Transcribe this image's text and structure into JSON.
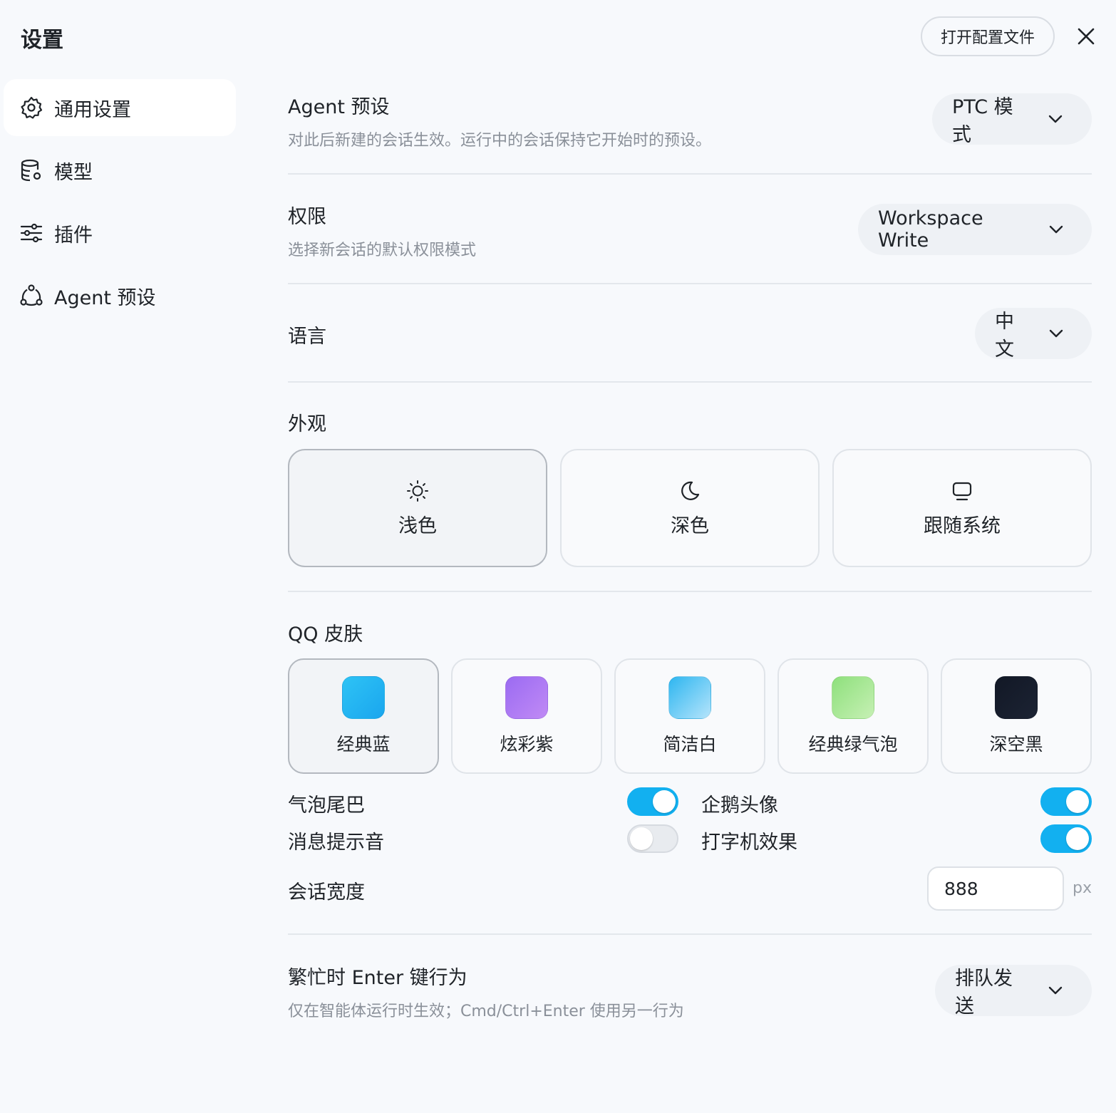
{
  "header": {
    "title": "设置",
    "open_config_label": "打开配置文件"
  },
  "sidebar": {
    "items": [
      {
        "label": "通用设置",
        "icon": "gear-icon",
        "active": true
      },
      {
        "label": "模型",
        "icon": "database-icon",
        "active": false
      },
      {
        "label": "插件",
        "icon": "sliders-icon",
        "active": false
      },
      {
        "label": "Agent 预设",
        "icon": "agent-icon",
        "active": false
      }
    ]
  },
  "settings": {
    "agent_preset": {
      "title": "Agent 预设",
      "desc": "对此后新建的会话生效。运行中的会话保持它开始时的预设。",
      "value": "PTC 模式"
    },
    "permission": {
      "title": "权限",
      "desc": "选择新会话的默认权限模式",
      "value": "Workspace Write"
    },
    "language": {
      "title": "语言",
      "value": "中文"
    },
    "appearance": {
      "title": "外观",
      "options": [
        {
          "label": "浅色",
          "icon": "sun-icon",
          "selected": true
        },
        {
          "label": "深色",
          "icon": "moon-icon",
          "selected": false
        },
        {
          "label": "跟随系统",
          "icon": "monitor-icon",
          "selected": false
        }
      ]
    },
    "qq_skin": {
      "title": "QQ 皮肤",
      "options": [
        {
          "label": "经典蓝",
          "color_from": "#2ec3f5",
          "color_to": "#1aa6ee",
          "selected": true
        },
        {
          "label": "炫彩紫",
          "color_from": "#9b6bf2",
          "color_to": "#c08af5",
          "selected": false
        },
        {
          "label": "简洁白",
          "color_from": "#2eb6f0",
          "color_to": "#b5e4fb",
          "selected": false
        },
        {
          "label": "经典绿气泡",
          "color_from": "#8ee07c",
          "color_to": "#c6f0b4",
          "selected": false
        },
        {
          "label": "深空黑",
          "color_from": "#121826",
          "color_to": "#1c2333",
          "selected": false
        }
      ]
    },
    "toggles": {
      "bubble_tail": {
        "label": "气泡尾巴",
        "on": true
      },
      "penguin_avatar": {
        "label": "企鹅头像",
        "on": true
      },
      "notify_sound": {
        "label": "消息提示音",
        "on": false
      },
      "typewriter": {
        "label": "打字机效果",
        "on": true
      }
    },
    "chat_width": {
      "label": "会话宽度",
      "value": "888",
      "unit": "px"
    },
    "busy_enter": {
      "title": "繁忙时 Enter 键行为",
      "desc": "仅在智能体运行时生效；Cmd/Ctrl+Enter 使用另一行为",
      "value": "排队发送"
    }
  },
  "colors": {
    "accent": "#12b0f0",
    "background": "#f7f9fc",
    "muted_text": "#8a9099"
  }
}
